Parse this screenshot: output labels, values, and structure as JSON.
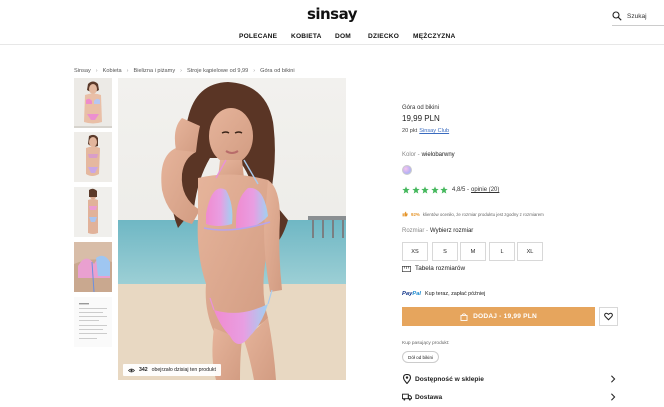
{
  "brand": {
    "logo": "sinsay"
  },
  "search": {
    "label": "Szukaj"
  },
  "nav": {
    "items": [
      "POLECANE",
      "KOBIETA",
      "DOM",
      "DZIECKO",
      "MĘŻCZYZNA"
    ]
  },
  "breadcrumb": [
    "Sinsay",
    "Kobieta",
    "Bielizna i piżamy",
    "Stroje kąpielowe od 9,99",
    "Góra od bikini"
  ],
  "gallery": {
    "viewers_count": "342",
    "viewers_text": "obejrzało dzisiaj ten produkt"
  },
  "product": {
    "name": "Góra od bikini",
    "price": "19,99 PLN",
    "points_prefix": "20 pkt",
    "club_link": "Sinsay Club",
    "color_label": "Kolor -",
    "color_value": "wielobarwny",
    "rating_value": "4,8/5 -",
    "reviews_link": "opinie (20)",
    "fit_percent": "92%",
    "fit_text": "klientów oceniło, że rozmiar produktu jest zgodny z rozmiarem",
    "size_label": "Rozmiar -",
    "size_prompt": "Wybierz rozmiar",
    "sizes": [
      "XS",
      "S",
      "M",
      "L",
      "XL"
    ],
    "size_table": "Tabela rozmiarów",
    "paypal_brand_a": "Pay",
    "paypal_brand_b": "Pal",
    "paypal_text": "Kup teraz, zapłać później",
    "add_to_cart": "DODAJ - 19,99 PLN",
    "match_label": "Kup pasujący produkt:",
    "match_item": "Dół od bikini",
    "availability": "Dostępność w sklepie",
    "delivery": "Dostawa"
  },
  "colors": {
    "accent": "#e6a55d",
    "star": "#45b85d",
    "link": "#3a6bbf"
  }
}
